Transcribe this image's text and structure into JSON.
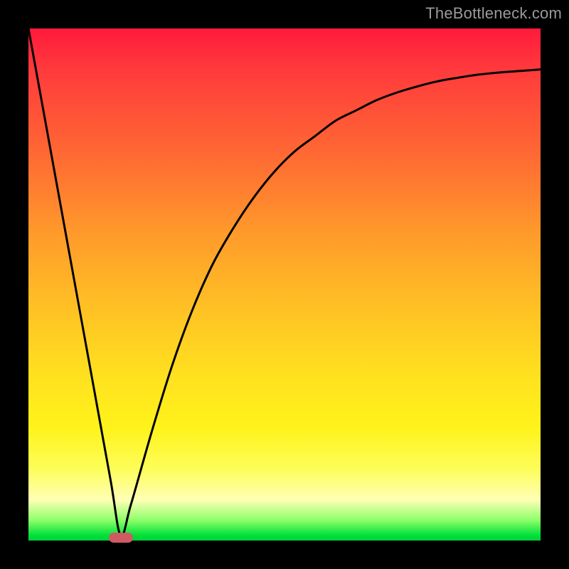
{
  "watermark": "TheBottleneck.com",
  "colors": {
    "frame": "#000000",
    "curve": "#000000",
    "marker": "#cf5a62",
    "gradient_top": "#ff1a3c",
    "gradient_bottom": "#00d038",
    "watermark_text": "#9a9a9a"
  },
  "chart_data": {
    "type": "line",
    "title": "",
    "xlabel": "",
    "ylabel": "",
    "xlim": [
      0,
      100
    ],
    "ylim": [
      0,
      100
    ],
    "grid": false,
    "legend": false,
    "notes": "x and y are relative 0–100 (percent of plot area). y=0 is bottom (green / good), y=100 is top (red / bad). Curve drops linearly to near y=0 at x≈18, then rises with a decelerating (saturating) curve toward ~y=92 at x=100.",
    "series": [
      {
        "name": "bottleneck-curve",
        "x": [
          0,
          4,
          8,
          12,
          16,
          18,
          20,
          24,
          28,
          32,
          36,
          40,
          44,
          48,
          52,
          56,
          60,
          64,
          68,
          72,
          76,
          80,
          84,
          88,
          92,
          96,
          100
        ],
        "y": [
          100,
          78,
          56,
          34,
          12,
          1,
          7,
          21,
          34,
          45,
          54,
          61,
          67,
          72,
          76,
          79,
          82,
          84,
          86,
          87.5,
          88.7,
          89.7,
          90.4,
          91,
          91.4,
          91.7,
          92
        ]
      }
    ],
    "marker": {
      "name": "optimal-point",
      "x": 18,
      "y": 0.5,
      "shape": "capsule"
    }
  }
}
